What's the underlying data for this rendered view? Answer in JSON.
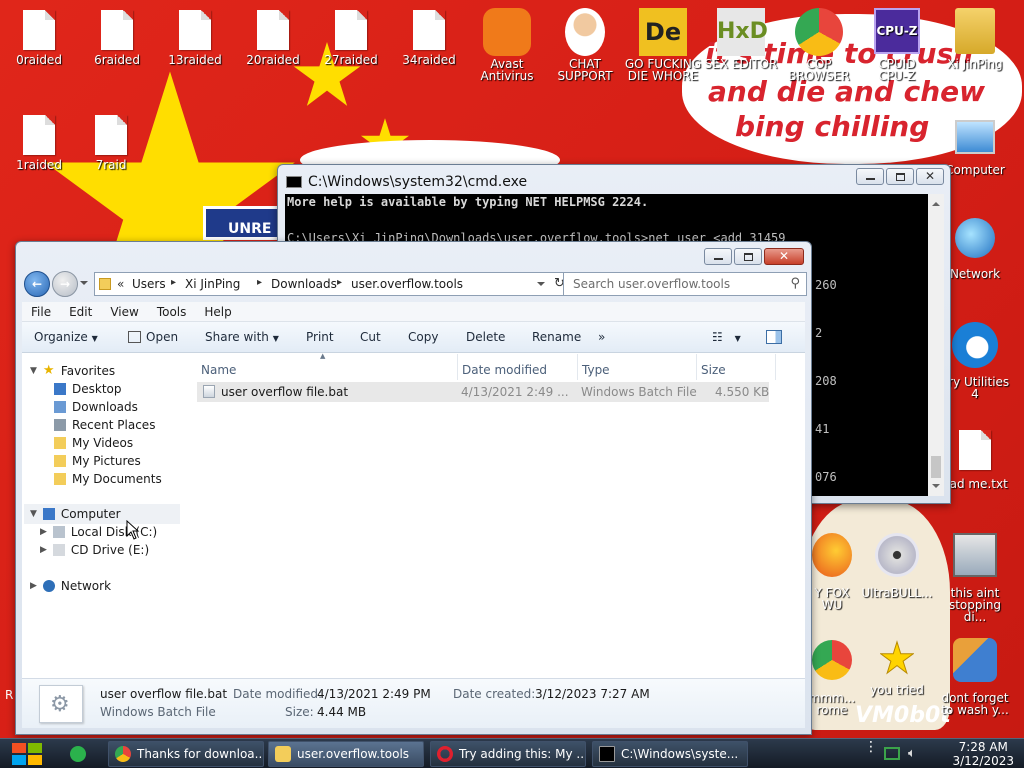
{
  "desktop": {
    "icons_left": [
      {
        "label": "0raided"
      },
      {
        "label": "6raided"
      },
      {
        "label": "13raided"
      },
      {
        "label": "20raided"
      },
      {
        "label": "27raided"
      },
      {
        "label": "34raided"
      },
      {
        "label": "1raided"
      },
      {
        "label": "7raid"
      }
    ],
    "icons_top": [
      {
        "label_1": "Avast",
        "label_2": "Antivirus"
      },
      {
        "label_1": "CHAT",
        "label_2": "SUPPORT"
      },
      {
        "label_1": "GO FUCKING",
        "label_2": "DIE WHORE"
      },
      {
        "label_1": "SEX EDITOR",
        "label_2": ""
      },
      {
        "label_1": "COP",
        "label_2": "BROWSER"
      },
      {
        "label_1": "CPUID",
        "label_2": "CPU-Z"
      },
      {
        "label_1": "Xi JinPing",
        "label_2": ""
      }
    ],
    "icons_right": [
      {
        "label_1": "Computer",
        "label_2": ""
      },
      {
        "label_1": "Network",
        "label_2": ""
      },
      {
        "label_1": "ary Utilities",
        "label_2": "4"
      },
      {
        "label_1": "ead me.txt",
        "label_2": ""
      },
      {
        "label_1": "this aint",
        "label_2": "stopping di..."
      },
      {
        "label_1": "dont forget",
        "label_2": "to wash y..."
      }
    ],
    "icons_partial": [
      {
        "label_1": "Y FOX",
        "label_2": "WU"
      },
      {
        "label_1": "UltraBULL...",
        "label_2": ""
      },
      {
        "label_1": "mmm...",
        "label_2": "rome"
      },
      {
        "label_1": "you tried",
        "label_2": ""
      }
    ],
    "bubble_lines": [
      "it's time to crush",
      "and die and chew",
      "bing chilling"
    ],
    "banner_text": "UNRE",
    "watermark": "VM0b0t",
    "partial_r": "R"
  },
  "cmd_window": {
    "title": "C:\\Windows\\system32\\cmd.exe",
    "lines": [
      "More help is available by typing NET HELPMSG 2224.",
      "",
      "C:\\Users\\Xi JinPing\\Downloads\\user.overflow.tools>net user <add 31459"
    ],
    "right_fragments": [
      "260",
      "2",
      "208",
      "41",
      "076"
    ]
  },
  "explorer": {
    "breadcrumb": [
      "Users",
      "Xi JinPing",
      "Downloads",
      "user.overflow.tools"
    ],
    "search_placeholder": "Search user.overflow.tools",
    "menu": [
      "File",
      "Edit",
      "View",
      "Tools",
      "Help"
    ],
    "toolbar": {
      "organize": "Organize",
      "open": "Open",
      "share_with": "Share with",
      "print": "Print",
      "cut": "Cut",
      "copy": "Copy",
      "delete": "Delete",
      "rename": "Rename",
      "more": "»"
    },
    "nav": {
      "favorites": "Favorites",
      "desktop": "Desktop",
      "downloads": "Downloads",
      "recent_places": "Recent Places",
      "my_videos": "My Videos",
      "my_pictures": "My Pictures",
      "my_documents": "My Documents",
      "computer": "Computer",
      "local_disk": "Local Disk (C:)",
      "cd_drive": "CD Drive (E:)",
      "network": "Network"
    },
    "columns": {
      "name": "Name",
      "date_modified": "Date modified",
      "type": "Type",
      "size": "Size"
    },
    "files": [
      {
        "name": "user overflow file.bat",
        "date_modified": "4/13/2021 2:49 ...",
        "type": "Windows Batch File",
        "size": "4.550 KB"
      }
    ],
    "details": {
      "name": "user overflow file.bat",
      "type": "Windows Batch File",
      "date_modified_label": "Date modified:",
      "date_modified": "4/13/2021 2:49 PM",
      "date_created_label": "Date created:",
      "date_created": "3/12/2023 7:27 AM",
      "size_label": "Size:",
      "size": "4.44 MB"
    }
  },
  "taskbar": {
    "buttons": [
      {
        "label": "Thanks for downloa..."
      },
      {
        "label": "user.overflow.tools"
      },
      {
        "label": "Try adding this: My ..."
      },
      {
        "label": "C:\\Windows\\syste..."
      }
    ],
    "time": "7:28 AM",
    "date": "3/12/2023"
  }
}
